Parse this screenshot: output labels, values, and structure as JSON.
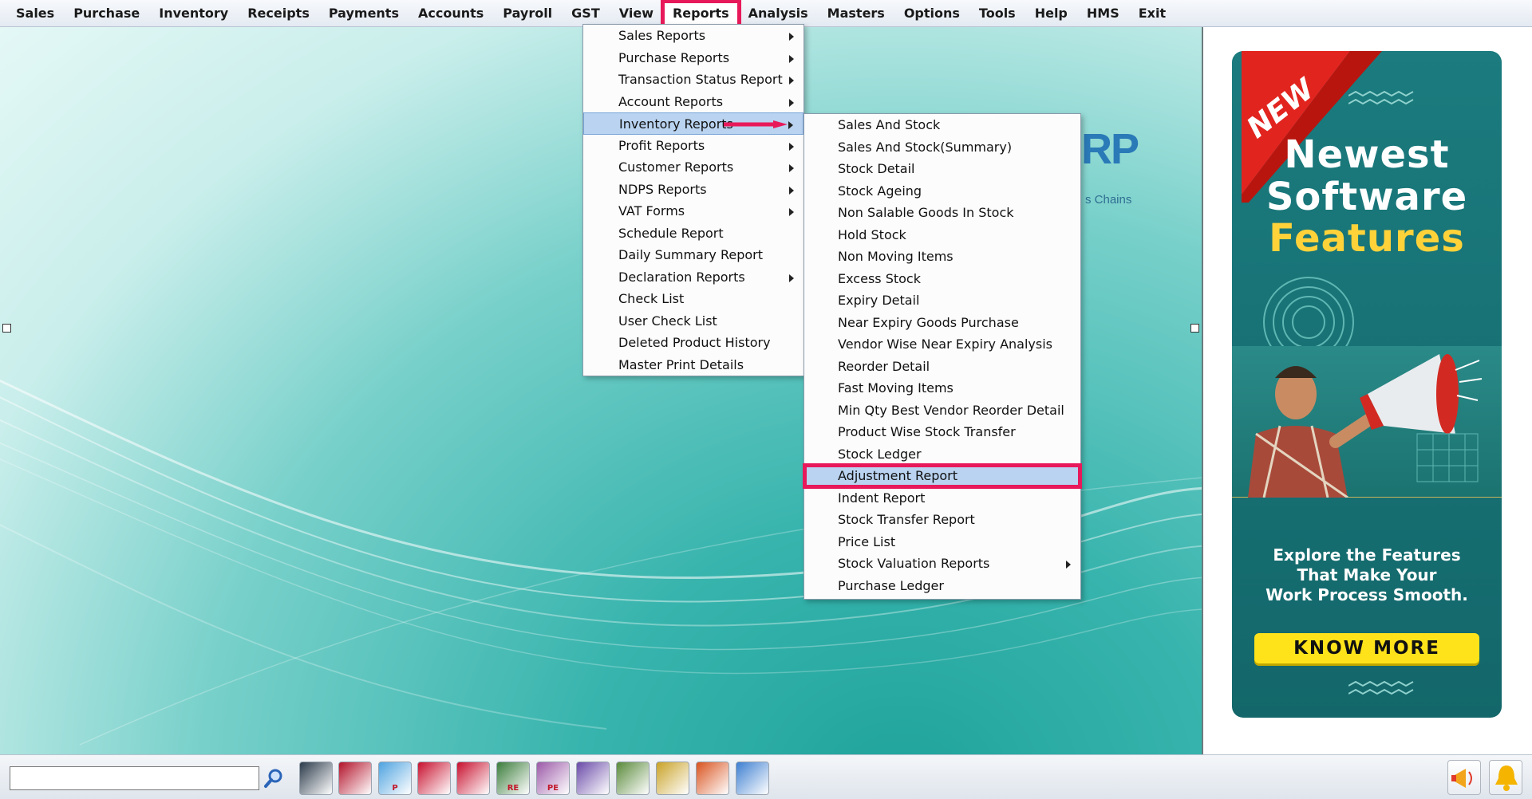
{
  "menubar": {
    "items": [
      "Sales",
      "Purchase",
      "Inventory",
      "Receipts",
      "Payments",
      "Accounts",
      "Payroll",
      "GST",
      "View",
      "Reports",
      "Analysis",
      "Masters",
      "Options",
      "Tools",
      "Help",
      "HMS",
      "Exit"
    ],
    "open_item": "Reports"
  },
  "reports_menu": {
    "items": [
      {
        "label": "Sales Reports",
        "submenu": true
      },
      {
        "label": "Purchase Reports",
        "submenu": true
      },
      {
        "label": "Transaction Status Report",
        "submenu": true
      },
      {
        "label": "Account Reports",
        "submenu": true
      },
      {
        "label": "Inventory Reports",
        "submenu": true
      },
      {
        "label": "Profit Reports",
        "submenu": true
      },
      {
        "label": "Customer Reports",
        "submenu": true
      },
      {
        "label": "NDPS Reports",
        "submenu": true
      },
      {
        "label": "VAT Forms",
        "submenu": true
      },
      {
        "label": "Schedule Report",
        "submenu": false
      },
      {
        "label": "Daily Summary Report",
        "submenu": false
      },
      {
        "label": "Declaration Reports",
        "submenu": true
      },
      {
        "label": "Check List",
        "submenu": false
      },
      {
        "label": "User Check List",
        "submenu": false
      },
      {
        "label": "Deleted Product History",
        "submenu": false
      },
      {
        "label": "Master Print Details",
        "submenu": false
      }
    ],
    "highlighted": "Inventory Reports"
  },
  "inventory_menu": {
    "items": [
      {
        "label": "Sales And Stock",
        "submenu": false
      },
      {
        "label": "Sales And Stock(Summary)",
        "submenu": false
      },
      {
        "label": "Stock Detail",
        "submenu": false
      },
      {
        "label": "Stock Ageing",
        "submenu": false
      },
      {
        "label": "Non Salable Goods In Stock",
        "submenu": false
      },
      {
        "label": "Hold Stock",
        "submenu": false
      },
      {
        "label": "Non Moving Items",
        "submenu": false
      },
      {
        "label": "Excess Stock",
        "submenu": false
      },
      {
        "label": "Expiry Detail",
        "submenu": false
      },
      {
        "label": "Near Expiry Goods Purchase",
        "submenu": false
      },
      {
        "label": "Vendor Wise Near Expiry Analysis",
        "submenu": false
      },
      {
        "label": "Reorder Detail",
        "submenu": false
      },
      {
        "label": "Fast Moving Items",
        "submenu": false
      },
      {
        "label": "Min Qty Best Vendor Reorder Detail",
        "submenu": false
      },
      {
        "label": "Product Wise Stock Transfer",
        "submenu": false
      },
      {
        "label": "Stock Ledger",
        "submenu": false
      },
      {
        "label": "Adjustment Report",
        "submenu": false
      },
      {
        "label": "Indent Report",
        "submenu": false
      },
      {
        "label": "Stock Transfer Report",
        "submenu": false
      },
      {
        "label": "Price List",
        "submenu": false
      },
      {
        "label": "Stock Valuation Reports",
        "submenu": true
      },
      {
        "label": "Purchase Ledger",
        "submenu": false
      }
    ],
    "highlighted": "Adjustment Report"
  },
  "background_logo": {
    "fragment": "RP",
    "subtitle_fragment": "s Chains"
  },
  "ad": {
    "ribbon": "NEW",
    "headline_1": "Newest",
    "headline_2": "Software",
    "headline_3": "Features",
    "copy_1": "Explore the Features",
    "copy_2": "That Make Your",
    "copy_3": "Work Process Smooth.",
    "cta": "KNOW MORE"
  },
  "toolbar": {
    "search_value": "",
    "icon_labels": [
      "",
      "",
      "P",
      "",
      "",
      "RE",
      "PE",
      "",
      "",
      "",
      "",
      ""
    ]
  },
  "colors": {
    "highlight_box": "#e8195a",
    "menu_selection": "#b9d3f0",
    "ad_bg": "#1b7b7e",
    "ad_accent": "#ffd23a"
  }
}
